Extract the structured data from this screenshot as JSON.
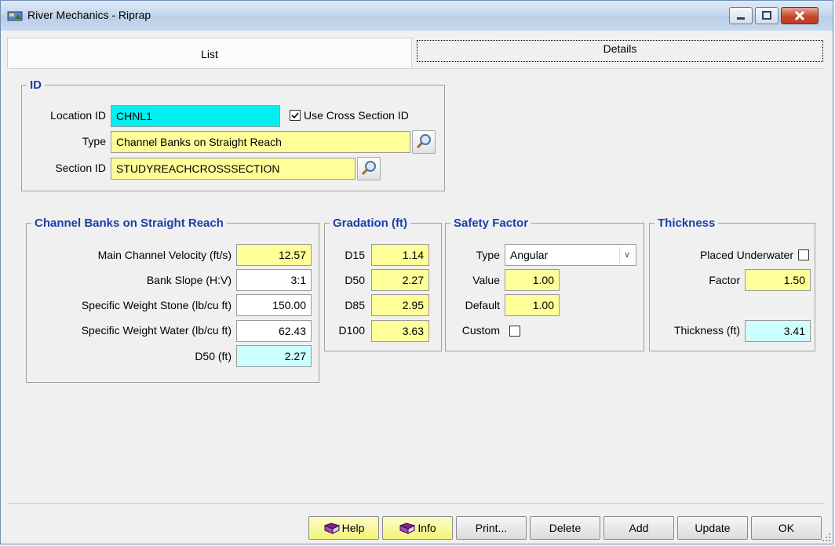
{
  "window": {
    "title": "River Mechanics - Riprap"
  },
  "tabs": [
    {
      "label": "List"
    },
    {
      "label": "Details"
    }
  ],
  "id_group": {
    "legend": "ID",
    "location_label": "Location ID",
    "location_value": "CHNL1",
    "use_xsec_label": "Use Cross Section ID",
    "use_xsec_checked": "☑",
    "type_label": "Type",
    "type_value": "Channel Banks on Straight Reach",
    "section_label": "Section ID",
    "section_value": "STUDYREACHCROSSSECTION"
  },
  "channel": {
    "legend": "Channel Banks on Straight Reach",
    "rows": [
      {
        "label": "Main Channel Velocity (ft/s)",
        "value": "12.57"
      },
      {
        "label": "Bank Slope (H:V)",
        "value": "3:1"
      },
      {
        "label": "Specific Weight Stone (lb/cu ft)",
        "value": "150.00"
      },
      {
        "label": "Specific Weight Water (lb/cu ft)",
        "value": "62.43"
      },
      {
        "label": "D50 (ft)",
        "value": "2.27"
      }
    ]
  },
  "gradation": {
    "legend": "Gradation (ft)",
    "rows": [
      {
        "label": "D15",
        "value": "1.14"
      },
      {
        "label": "D50",
        "value": "2.27"
      },
      {
        "label": "D85",
        "value": "2.95"
      },
      {
        "label": "D100",
        "value": "3.63"
      }
    ]
  },
  "safety": {
    "legend": "Safety Factor",
    "type_label": "Type",
    "type_value": "Angular",
    "value_label": "Value",
    "value_value": "1.00",
    "default_label": "Default",
    "default_value": "1.00",
    "custom_label": "Custom"
  },
  "thickness": {
    "legend": "Thickness",
    "placed_label": "Placed Underwater",
    "factor_label": "Factor",
    "factor_value": "1.50",
    "thickness_label": "Thickness (ft)",
    "thickness_value": "3.41"
  },
  "buttons": {
    "help": "Help",
    "info": "Info",
    "print": "Print...",
    "delete": "Delete",
    "add": "Add",
    "update": "Update",
    "ok": "OK"
  },
  "colors": {
    "required": "#ffff99",
    "key": "#00f0f0",
    "computed": "#ccffff",
    "legend": "#1c3fa8"
  },
  "icons": [
    "app-icon",
    "search-icon",
    "book-icon",
    "minimize-icon",
    "maximize-icon",
    "close-icon"
  ]
}
